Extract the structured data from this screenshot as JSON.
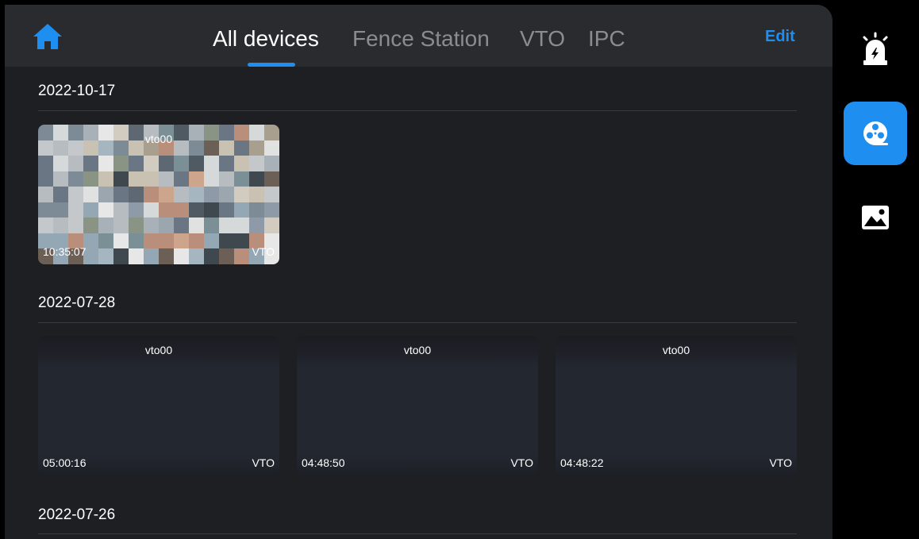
{
  "header": {
    "tabs": [
      {
        "label": "All devices",
        "active": true
      },
      {
        "label": "Fence Station",
        "active": false
      },
      {
        "label": "VTO",
        "active": false
      },
      {
        "label": "IPC",
        "active": false
      }
    ],
    "edit_label": "Edit",
    "home_icon": "home-icon"
  },
  "groups": [
    {
      "date": "2022-10-17",
      "records": [
        {
          "camera": "vto00",
          "time": "10:35:07",
          "type": "VTO",
          "has_image": true
        }
      ]
    },
    {
      "date": "2022-07-28",
      "records": [
        {
          "camera": "vto00",
          "time": "05:00:16",
          "type": "VTO",
          "has_image": false
        },
        {
          "camera": "vto00",
          "time": "04:48:50",
          "type": "VTO",
          "has_image": false
        },
        {
          "camera": "vto00",
          "time": "04:48:22",
          "type": "VTO",
          "has_image": false
        }
      ]
    },
    {
      "date": "2022-07-26",
      "records": []
    }
  ],
  "sidebar": {
    "items": [
      {
        "icon": "alarm-icon",
        "active": false
      },
      {
        "icon": "video-reel-icon",
        "active": true
      },
      {
        "icon": "picture-icon",
        "active": false
      }
    ]
  },
  "colors": {
    "accent": "#1e8ef0",
    "background": "#1e1f23",
    "topbar": "#2a2b2f"
  }
}
